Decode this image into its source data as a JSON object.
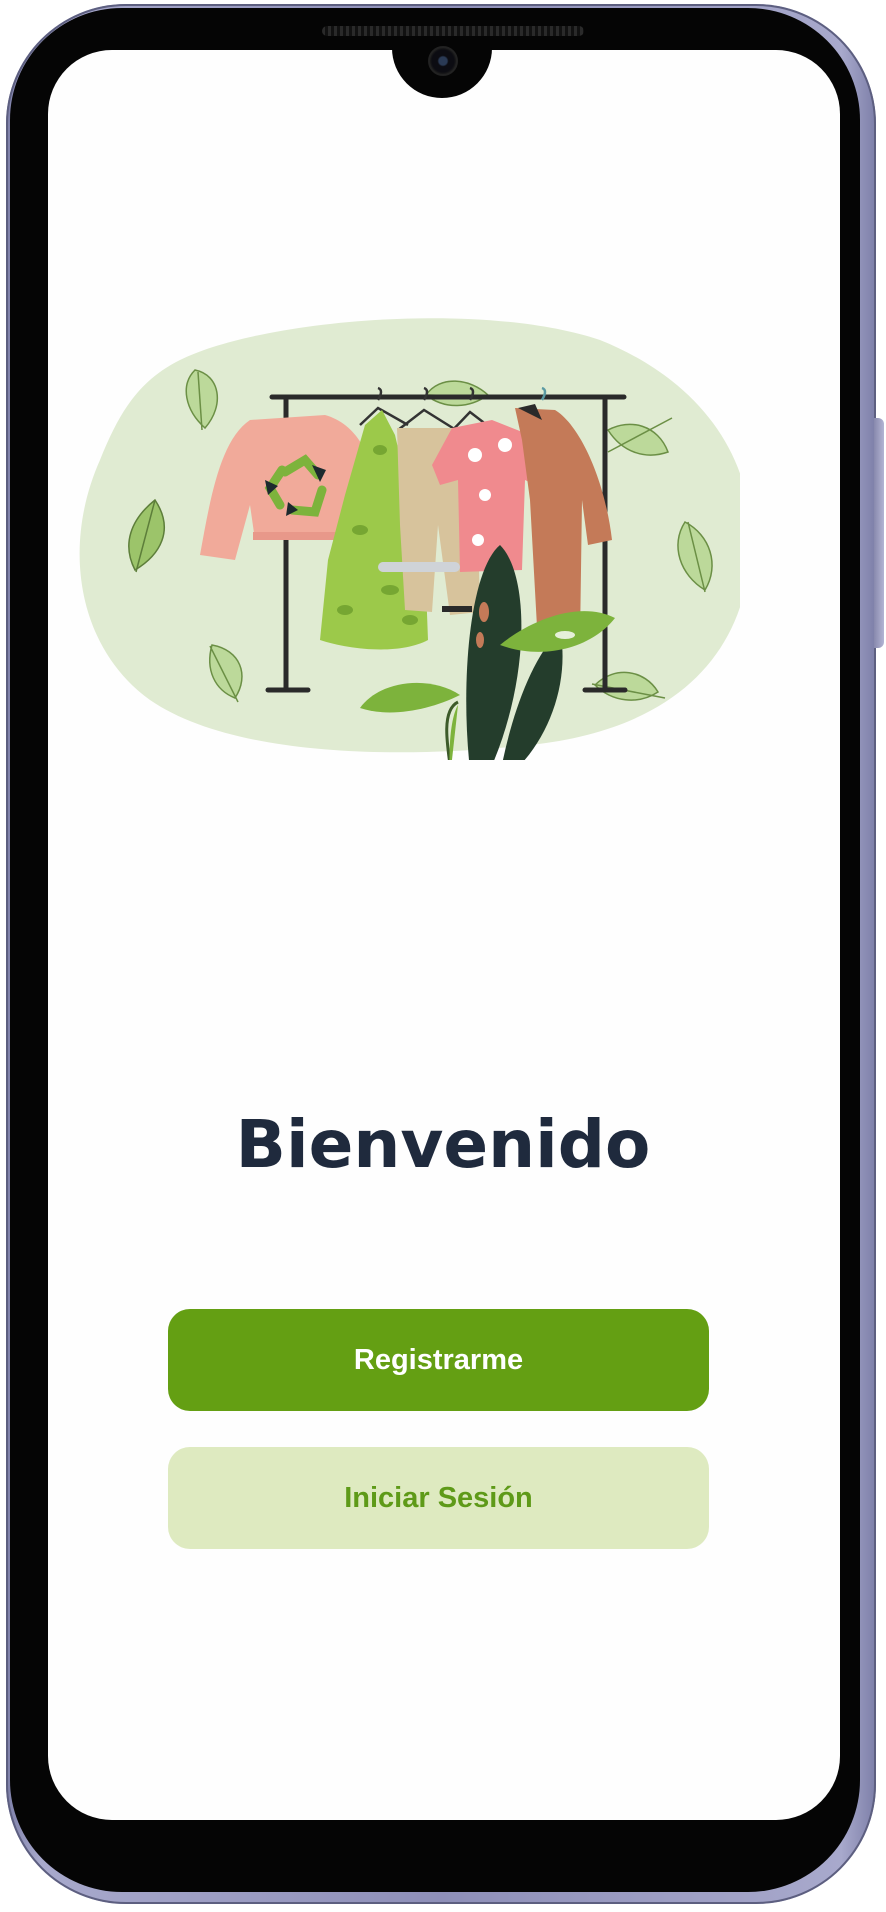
{
  "welcome": {
    "title": "Bienvenido"
  },
  "actions": {
    "register_label": "Registrarme",
    "login_label": "Iniciar Sesión"
  },
  "colors": {
    "primary": "#649f13",
    "secondary_bg": "#deeac0",
    "secondary_text": "#5e9a18",
    "title": "#1f2a3d",
    "illustration_bg": "#e0ebd2"
  },
  "illustration": {
    "icon": "clothing-rack-illustration"
  }
}
